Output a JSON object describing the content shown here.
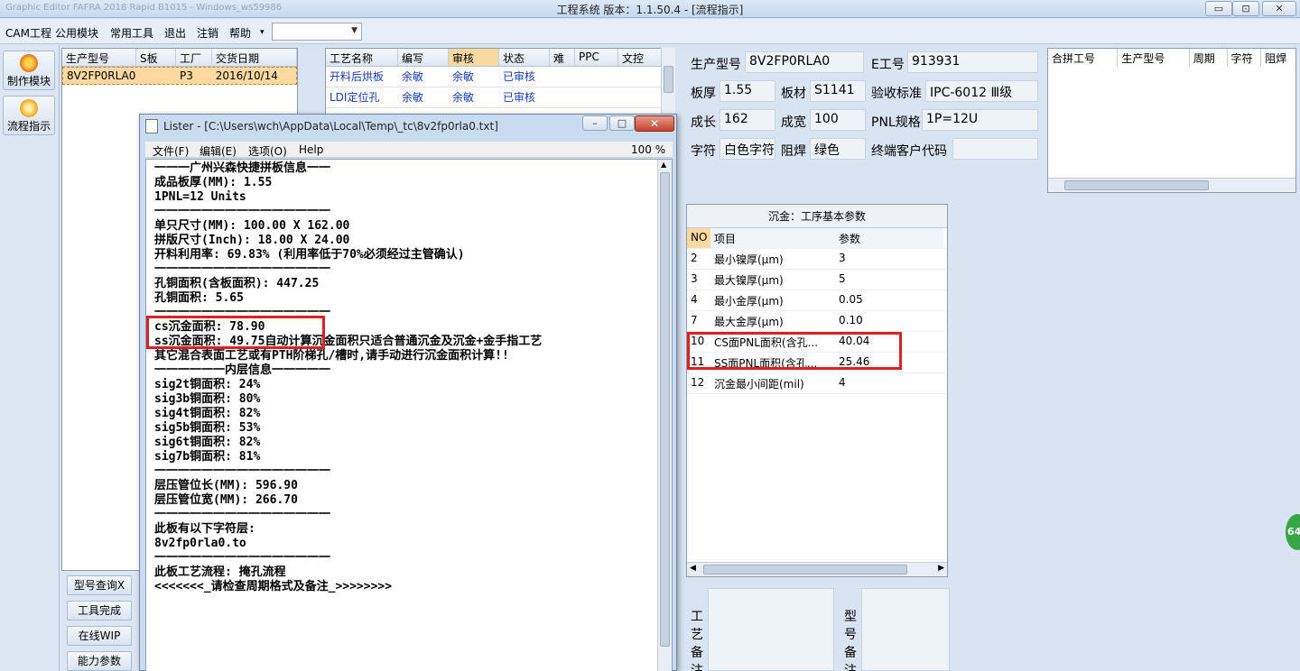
{
  "window": {
    "title_faded": "Graphic Editor FAFRA 2018 Rapid B1015 - Windows_ws59986",
    "app_title": "工程系统   版本：1.1.50.4 - [流程指示]",
    "btn_min": "▭",
    "btn_max": "⊡",
    "btn_close": "✕"
  },
  "menubar": {
    "items": [
      "CAM工程",
      "公用模块",
      "常用工具",
      "退出",
      "注销",
      "帮助"
    ],
    "help_arrow": "▾",
    "combo_value": "",
    "mdi": "– ⧉ ✕"
  },
  "left_toolbar": [
    {
      "label": "制作模块",
      "color": "#e8701a"
    },
    {
      "label": "流程指示",
      "color": "#f0a020"
    }
  ],
  "grid1": {
    "headers": [
      "生产型号",
      "S板",
      "工厂",
      "交货日期"
    ],
    "rows": [
      [
        "8V2FP0RLA0",
        "",
        "P3",
        "2016/10/14"
      ]
    ]
  },
  "left_buttons": [
    "型号查询X",
    "工具完成",
    "在线WIP",
    "能力参数"
  ],
  "grid2": {
    "headers": [
      "工艺名称",
      "编写",
      "审核",
      "状态",
      "难",
      "PPC",
      "文控"
    ],
    "rows": [
      [
        "开料后烘板",
        "余敏",
        "余敏",
        "已审核",
        "",
        "",
        ""
      ],
      [
        "LDI定位孔",
        "余敏",
        "余敏",
        "已审核",
        "",
        "",
        ""
      ]
    ]
  },
  "info": {
    "prod_label": "生产型号",
    "prod_value": "8V2FP0RLA0",
    "e_label": "E工号",
    "e_value": "913931",
    "thick_label": "板厚",
    "thick_value": "1.55",
    "mat_label": "板材",
    "mat_value": "S1141",
    "std_label": "验收标准",
    "std_value": "IPC-6012 Ⅲ级",
    "len_label": "成长",
    "len_value": "162",
    "wid_label": "成宽",
    "wid_value": "100",
    "pnl_label": "PNL规格",
    "pnl_value": "1P=12U",
    "char_label": "字符",
    "char_value": "白色字符",
    "mask_label": "阻焊",
    "mask_value": "绿色",
    "cust_label": "终端客户代码",
    "cust_value": ""
  },
  "grid3": {
    "headers": [
      "合拼工号",
      "生产型号",
      "周期",
      "字符",
      "阻焊"
    ]
  },
  "grid4": {
    "title": "沉金：工序基本参数",
    "headers": [
      "NO",
      "项目",
      "参数"
    ],
    "rows": [
      [
        "2",
        "最小镍厚(μm)",
        "3"
      ],
      [
        "3",
        "最大镍厚(μm)",
        "5"
      ],
      [
        "4",
        "最小金厚(μm)",
        "0.05"
      ],
      [
        "7",
        "最大金厚(μm)",
        "0.10"
      ],
      [
        "10",
        "CS面PNL面积(含孔...",
        "40.04"
      ],
      [
        "11",
        "SS面PNL面积(含孔...",
        "25.46"
      ],
      [
        "12",
        "沉金最小间距(mil)",
        "4"
      ]
    ]
  },
  "remarks": {
    "left": [
      "工",
      "艺",
      "备",
      "注"
    ],
    "right": [
      "型",
      "号",
      "备",
      "注"
    ]
  },
  "lister": {
    "title": "Lister - [C:\\Users\\wch\\AppData\\Local\\Temp\\_tc\\8v2fp0rla0.txt]",
    "menu": [
      "文件(F)",
      "编辑(E)",
      "选项(O)",
      "Help"
    ],
    "zoom": "100 %",
    "lines": [
      "一一一广州兴森快捷拼板信息一一",
      "成品板厚(MM): 1.55",
      "1PNL=12 Units",
      "一一一一一一一一一一一一一一一",
      "单只尺寸(MM): 100.00 X 162.00",
      "拼版尺寸(Inch): 18.00 X 24.00",
      "开料利用率: 69.83% (利用率低于70%必须经过主管确认)",
      "一一一一一一一一一一一一一一一",
      "孔铜面积(含板面积): 447.25",
      "孔铜面积: 5.65",
      "一一一一一一一一一一一一一一一",
      "cs沉金面积: 78.90",
      "ss沉金面积: 49.75自动计算沉金面积只适合普通沉金及沉金+金手指工艺",
      "其它混合表面工艺或有PTH阶梯孔/槽时,请手动进行沉金面积计算!!",
      "一一一一一一内层信息一一一一一",
      "sig2t铜面积: 24%",
      "sig3b铜面积: 80%",
      "sig4t铜面积: 82%",
      "sig5b铜面积: 53%",
      "sig6t铜面积: 82%",
      "sig7b铜面积: 81%",
      "一一一一一一一一一一一一一一一",
      "层压管位长(MM): 596.90",
      "层压管位宽(MM): 266.70",
      "一一一一一一一一一一一一一一一",
      "此板有以下字符层:",
      "8v2fp0rla0.to",
      "一一一一一一一一一一一一一一一",
      "此板工艺流程: 掩孔流程",
      "<<<<<<<_请检查周期格式及备注_>>>>>>>>"
    ]
  },
  "badge": "64"
}
